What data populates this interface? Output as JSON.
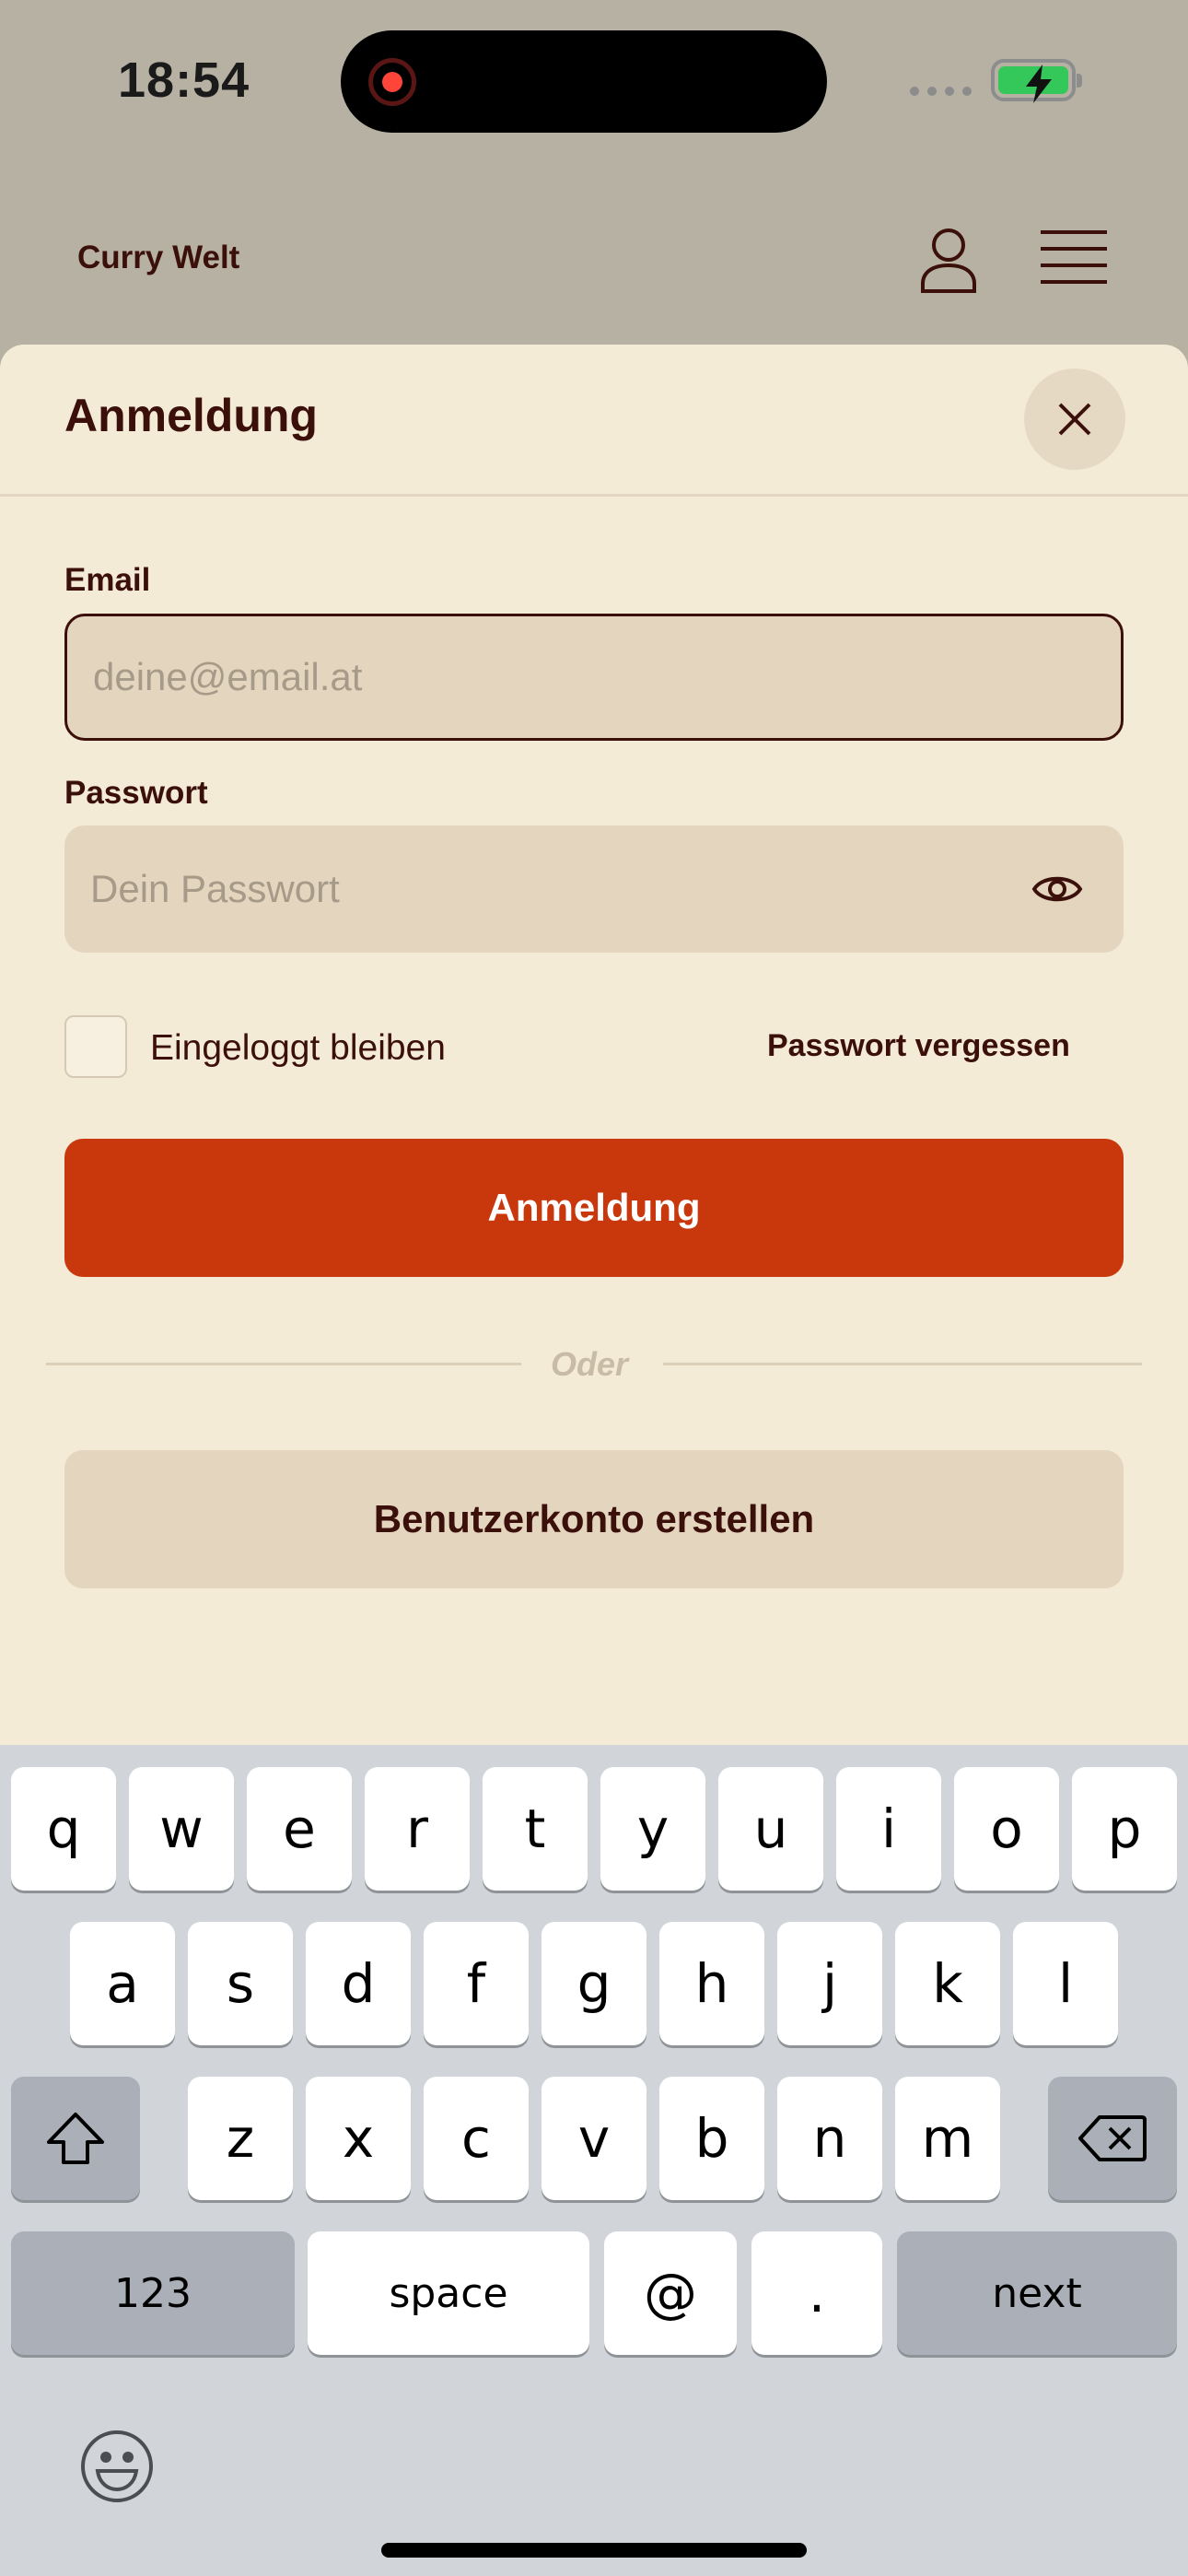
{
  "status_bar": {
    "time": "18:54"
  },
  "header": {
    "brand": "Curry Welt"
  },
  "sheet": {
    "title": "Anmeldung",
    "email": {
      "label": "Email",
      "placeholder": "deine@email.at",
      "value": ""
    },
    "password": {
      "label": "Passwort",
      "placeholder": "Dein Passwort",
      "value": ""
    },
    "remember_label": "Eingeloggt bleiben",
    "forgot_label": "Passwort vergessen",
    "submit_label": "Anmeldung",
    "divider_label": "Oder",
    "register_label": "Benutzerkonto erstellen"
  },
  "keyboard": {
    "row1": [
      "q",
      "w",
      "e",
      "r",
      "t",
      "y",
      "u",
      "i",
      "o",
      "p"
    ],
    "row2": [
      "a",
      "s",
      "d",
      "f",
      "g",
      "h",
      "j",
      "k",
      "l"
    ],
    "row3": [
      "z",
      "x",
      "c",
      "v",
      "b",
      "n",
      "m"
    ],
    "numbers_label": "123",
    "space_label": "space",
    "at_label": "@",
    "dot_label": ".",
    "next_label": "next"
  },
  "colors": {
    "primary": "#c9380c",
    "sheet_background": "#f4ebd6",
    "field_background": "#e4d5bf",
    "text": "#3b0f0a",
    "battery": "#34c759"
  },
  "icons": [
    "record-icon",
    "battery-charging-icon",
    "user-icon",
    "menu-icon",
    "close-icon",
    "eye-icon",
    "shift-icon",
    "backspace-icon",
    "emoji-icon"
  ]
}
